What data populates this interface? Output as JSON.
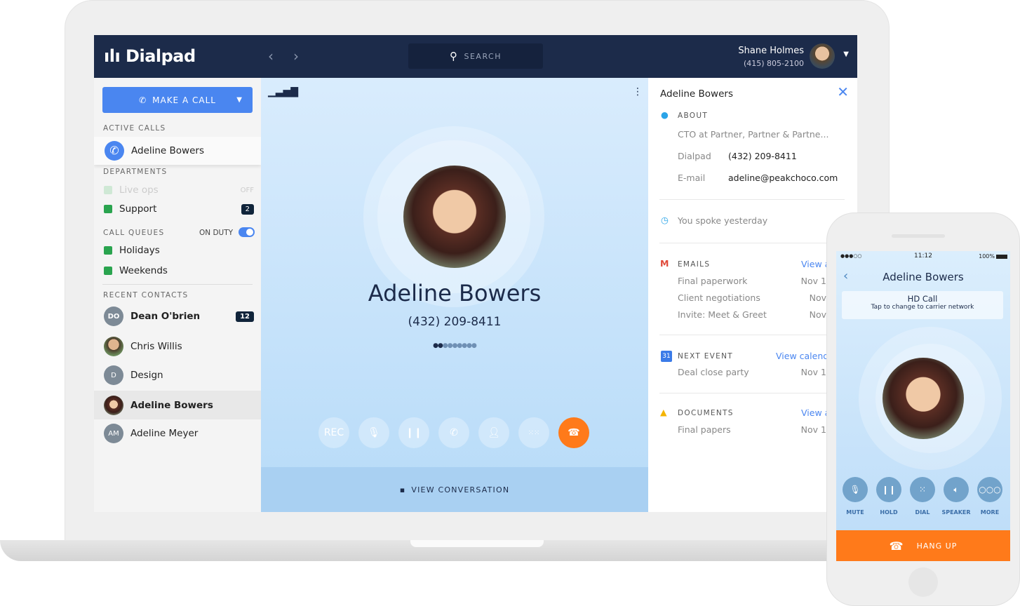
{
  "header": {
    "brand": "Dialpad",
    "search_label": "SEARCH",
    "user_name": "Shane Holmes",
    "user_phone": "(415) 805-2100"
  },
  "sidebar": {
    "make_call": "MAKE A CALL",
    "active_calls_title": "ACTIVE CALLS",
    "active_call": "Adeline Bowers",
    "departments_title": "DEPARTMENTS",
    "departments": [
      {
        "label": "Live ops",
        "status": "OFF"
      },
      {
        "label": "Support",
        "badge": "2"
      }
    ],
    "queues_title": "CALL QUEUES",
    "on_duty": "ON DUTY",
    "queues": [
      "Holidays",
      "Weekends"
    ],
    "recent_title": "RECENT CONTACTS",
    "recent": [
      {
        "initials": "DO",
        "name": "Dean O'brien",
        "badge": "12"
      },
      {
        "initials": "",
        "name": "Chris Willis"
      },
      {
        "initials": "D",
        "name": "Design"
      },
      {
        "initials": "",
        "name": "Adeline Bowers"
      },
      {
        "initials": "AM",
        "name": "Adeline Meyer"
      }
    ]
  },
  "call": {
    "name": "Adeline Bowers",
    "number": "(432) 209-8411",
    "buttons": [
      "REC",
      "mute",
      "hold",
      "transfer",
      "add-person",
      "keypad",
      "hang-up"
    ],
    "view_conversation": "VIEW CONVERSATION"
  },
  "contact": {
    "name": "Adeline Bowers",
    "about_title": "ABOUT",
    "title": "CTO at Partner, Partner & Partne...",
    "dialpad_label": "Dialpad",
    "dialpad_value": "(432) 209-8411",
    "email_label": "E-mail",
    "email_value": "adeline@peakchoco.com",
    "spoke": "You spoke yesterday",
    "emails_title": "EMAILS",
    "emails_link": "View a",
    "emails": [
      {
        "s": "Final paperwork",
        "d": "Nov 1"
      },
      {
        "s": "Client negotiations",
        "d": "Nov"
      },
      {
        "s": "Invite: Meet & Greet",
        "d": "Nov"
      }
    ],
    "event_title": "NEXT EVENT",
    "event_link": "View calend",
    "event_icon": "31",
    "events": [
      {
        "s": "Deal close party",
        "d": "Nov 1"
      }
    ],
    "docs_title": "DOCUMENTS",
    "docs_link": "View a",
    "docs": [
      {
        "s": "Final papers",
        "d": "Nov 1"
      }
    ]
  },
  "phone": {
    "signal": "●●●○○",
    "time": "11:12",
    "battery": "100%",
    "name": "Adeline Bowers",
    "hd_title": "HD Call",
    "hd_sub": "Tap to change to carrier network",
    "buttons": [
      "MUTE",
      "HOLD",
      "DIAL",
      "SPEAKER",
      "MORE"
    ],
    "hang_up": "HANG UP"
  },
  "colors": {
    "header": "#1c2b4a",
    "accent": "#4a86f0",
    "hangup": "#ff7a1a",
    "green": "#2aa44f"
  }
}
